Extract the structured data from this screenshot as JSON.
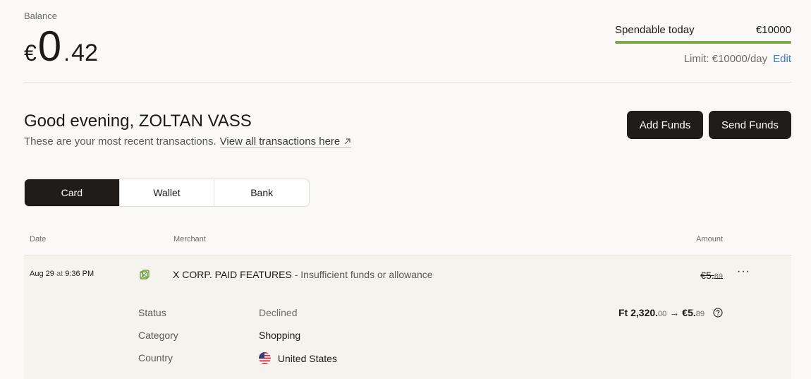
{
  "balance": {
    "label": "Balance",
    "currency": "€",
    "integer": "0",
    "separator": ".",
    "decimal": "42"
  },
  "spend": {
    "label": "Spendable today",
    "amount": "€10000",
    "progress_fraction": 1.0,
    "limit_text": "Limit: €10000/day",
    "edit_label": "Edit"
  },
  "greeting": {
    "title": "Good evening, ZOLTAN VASS",
    "subtitle": "These are your most recent transactions.",
    "view_all": "View all transactions here"
  },
  "actions": {
    "add_funds": "Add Funds",
    "send_funds": "Send Funds"
  },
  "tabs": [
    {
      "label": "Card",
      "active": true
    },
    {
      "label": "Wallet",
      "active": false
    },
    {
      "label": "Bank",
      "active": false
    }
  ],
  "table": {
    "headers": {
      "date": "Date",
      "merchant": "Merchant",
      "amount": "Amount"
    },
    "transaction": {
      "date": "Aug 29",
      "at": "at",
      "time": "9:36 PM",
      "merchant": "X CORP. PAID FEATURES",
      "separator": "-",
      "reason": "Insufficient funds or allowance",
      "amount_main": "€5.",
      "amount_cents": "89",
      "more": "···",
      "details": {
        "status_label": "Status",
        "status_value": "Declined",
        "category_label": "Category",
        "category_value": "Shopping",
        "country_label": "Country",
        "country_value": "United States"
      },
      "conversion": {
        "from_main": "Ft 2,320.",
        "from_cents": "00",
        "arrow": "→",
        "to_main": "€5.",
        "to_cents": "89"
      }
    }
  },
  "colors": {
    "accent_green": "#7fa84e",
    "link_blue": "#3a78c4",
    "dark_button": "#1f1c19",
    "icon_green": "#6e9e3c"
  }
}
